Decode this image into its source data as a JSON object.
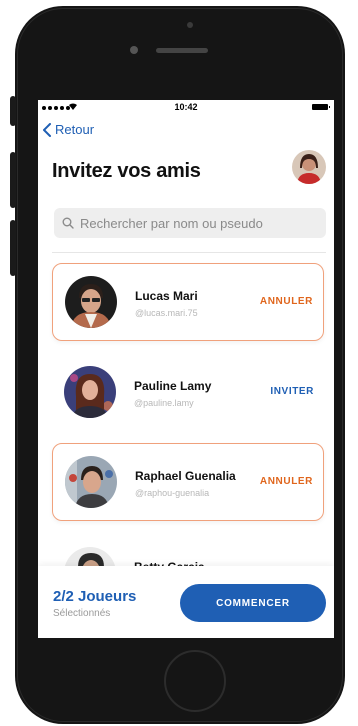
{
  "status_bar": {
    "time": "10:42"
  },
  "nav": {
    "back_label": "Retour"
  },
  "header": {
    "title": "Invitez vos amis"
  },
  "search": {
    "placeholder": "Rechercher par nom ou pseudo",
    "value": ""
  },
  "friends": [
    {
      "name": "Lucas Mari",
      "handle": "@lucas.mari.75",
      "action": "ANNULER",
      "selected": true
    },
    {
      "name": "Pauline Lamy",
      "handle": "@pauline.lamy",
      "action": "INVITER",
      "selected": false
    },
    {
      "name": "Raphael Guenalia",
      "handle": "@raphou-guenalia",
      "action": "ANNULER",
      "selected": true
    },
    {
      "name": "Betty Garcia",
      "handle": "",
      "action": "",
      "selected": false
    }
  ],
  "footer": {
    "count": "2/2 Joueurs",
    "count_label": "Sélectionnés",
    "start_label": "COMMENCER"
  },
  "colors": {
    "primary": "#1f5fb4",
    "cancel": "#e0661d",
    "selected_border": "#f0a17c"
  },
  "icons": [
    "back-chevron-icon",
    "search-icon",
    "wifi-icon",
    "battery-icon",
    "signal-icon"
  ]
}
